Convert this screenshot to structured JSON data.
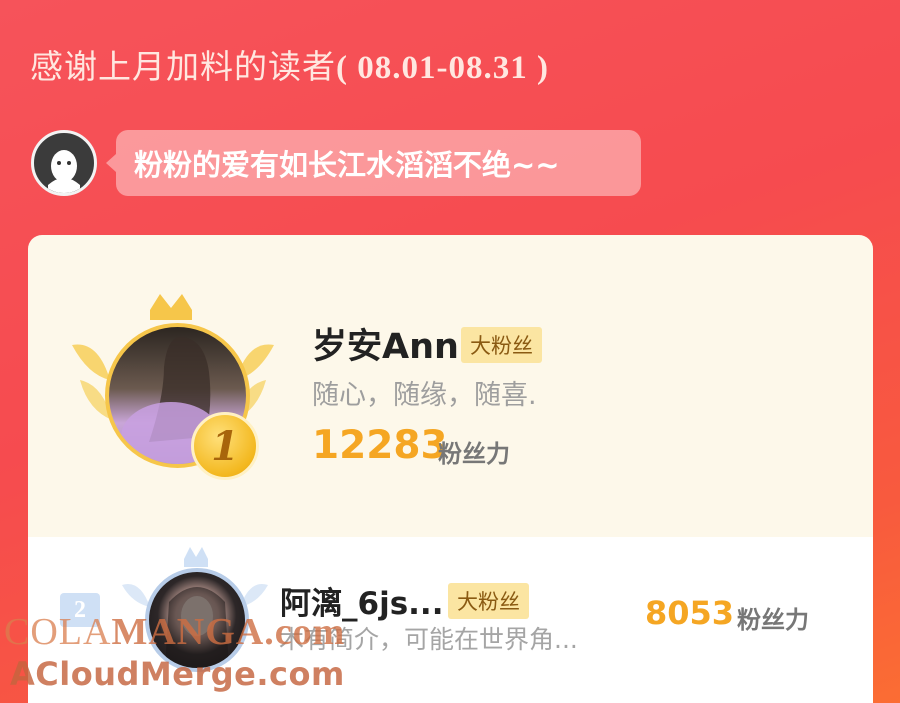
{
  "header": {
    "title": "感谢上月加料的读者",
    "range": "( 08.01-08.31 )"
  },
  "message": {
    "text": "粉粉的爱有如长江水滔滔不绝~~"
  },
  "ranking": [
    {
      "rank": "1",
      "name": "岁安Ann",
      "badge": "大粉丝",
      "bio": "随心，随缘，随喜.",
      "score": "12283",
      "unit": "粉丝力"
    },
    {
      "rank": "2",
      "name": "阿漓_6js...",
      "badge": "大粉丝",
      "bio": "木有简介，可能在世界角...",
      "score": "8053",
      "unit": "粉丝力"
    }
  ],
  "watermark": {
    "line1_a": "COLA",
    "line1_b": "MANGA",
    "line1_c": ".com",
    "line2": "ACloudMerge.com"
  },
  "colors": {
    "background": "#f6535a",
    "gold": "#f5a623",
    "card": "#fdf8ea"
  }
}
